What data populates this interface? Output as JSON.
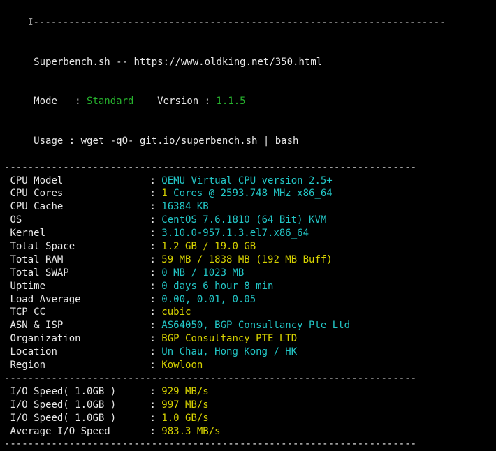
{
  "header": {
    "script": "Superbench.sh",
    "sep": " -- ",
    "url": "https://www.oldking.net/350.html",
    "mode_label": "Mode   : ",
    "mode_value": "Standard",
    "mode_pad": "    ",
    "version_label": "Version : ",
    "version_value": "1.1.5",
    "usage_label": "Usage : ",
    "usage_value": "wget -qO- git.io/superbench.sh | bash"
  },
  "divider": "----------------------------------------------------------------------",
  "sys": [
    {
      "label": "CPU Model",
      "value": "QEMU Virtual CPU version 2.5+",
      "cls": "cyan"
    },
    {
      "label": "CPU Cores",
      "value": "1 Cores @ 2593.748 MHz x86_64",
      "cls": "cyan",
      "leadnum": true
    },
    {
      "label": "CPU Cache",
      "value": "16384 KB",
      "cls": "cyan"
    },
    {
      "label": "OS",
      "value": "CentOS 7.6.1810 (64 Bit) KVM",
      "cls": "cyan"
    },
    {
      "label": "Kernel",
      "value": "3.10.0-957.1.3.el7.x86_64",
      "cls": "cyan"
    },
    {
      "label": "Total Space",
      "value": "1.2 GB / 19.0 GB",
      "cls": "yellow"
    },
    {
      "label": "Total RAM",
      "value": "59 MB / 1838 MB (192 MB Buff)",
      "cls": "yellow"
    },
    {
      "label": "Total SWAP",
      "value": "0 MB / 1023 MB",
      "cls": "cyan"
    },
    {
      "label": "Uptime",
      "value": "0 days 6 hour 8 min",
      "cls": "cyan"
    },
    {
      "label": "Load Average",
      "value": "0.00, 0.01, 0.05",
      "cls": "cyan"
    },
    {
      "label": "TCP CC",
      "value": "cubic",
      "cls": "yellow"
    },
    {
      "label": "ASN & ISP",
      "value": "AS64050, BGP Consultancy Pte Ltd",
      "cls": "cyan"
    },
    {
      "label": "Organization",
      "value": "BGP Consultancy PTE LTD",
      "cls": "yellow"
    },
    {
      "label": "Location",
      "value": "Un Chau, Hong Kong / HK",
      "cls": "cyan"
    },
    {
      "label": "Region",
      "value": "Kowloon",
      "cls": "yellow"
    }
  ],
  "io": [
    {
      "label": "I/O Speed( 1.0GB )",
      "value": "929 MB/s",
      "cls": "yellow"
    },
    {
      "label": "I/O Speed( 1.0GB )",
      "value": "997 MB/s",
      "cls": "yellow"
    },
    {
      "label": "I/O Speed( 1.0GB )",
      "value": "1.0 GB/s",
      "cls": "yellow"
    },
    {
      "label": "Average I/O Speed",
      "value": "983.3 MB/s",
      "cls": "yellow"
    }
  ]
}
